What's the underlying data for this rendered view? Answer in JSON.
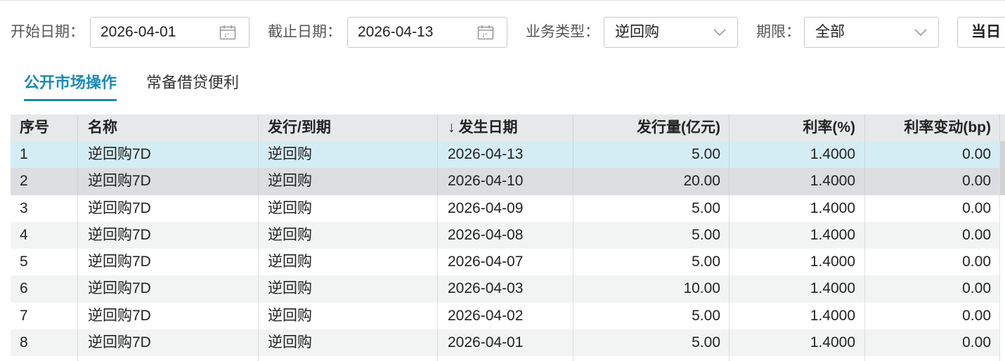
{
  "filters": {
    "start_date": {
      "label": "开始日期：",
      "value": "2026-04-01"
    },
    "end_date": {
      "label": "截止日期：",
      "value": "2026-04-13"
    },
    "business_type": {
      "label": "业务类型：",
      "value": "逆回购"
    },
    "term": {
      "label": "期限：",
      "value": "全部"
    },
    "today_button": {
      "label": "当日"
    }
  },
  "icons": {
    "date_picker": "calendar-icon",
    "select": "chevron-down-icon",
    "sort": "sort-desc-icon"
  },
  "tabs": [
    {
      "label": "公开市场操作",
      "active": true
    },
    {
      "label": "常备借贷便利",
      "active": false
    }
  ],
  "table": {
    "columns": [
      "序号",
      "名称",
      "发行/到期",
      "发生日期",
      "发行量(亿元)",
      "利率(%)",
      "利率变动(bp)"
    ],
    "sort_indicator": "↓",
    "rows": [
      {
        "cells": [
          "1",
          "逆回购7D",
          "逆回购",
          "2026-04-13",
          "5.00",
          "1.4000",
          "0.00"
        ],
        "selected": true,
        "hovered": false
      },
      {
        "cells": [
          "2",
          "逆回购7D",
          "逆回购",
          "2026-04-10",
          "20.00",
          "1.4000",
          "0.00"
        ],
        "selected": false,
        "hovered": true
      },
      {
        "cells": [
          "3",
          "逆回购7D",
          "逆回购",
          "2026-04-09",
          "5.00",
          "1.4000",
          "0.00"
        ],
        "selected": false,
        "hovered": false
      },
      {
        "cells": [
          "4",
          "逆回购7D",
          "逆回购",
          "2026-04-08",
          "5.00",
          "1.4000",
          "0.00"
        ],
        "selected": false,
        "hovered": false
      },
      {
        "cells": [
          "5",
          "逆回购7D",
          "逆回购",
          "2026-04-07",
          "5.00",
          "1.4000",
          "0.00"
        ],
        "selected": false,
        "hovered": false
      },
      {
        "cells": [
          "6",
          "逆回购7D",
          "逆回购",
          "2026-04-03",
          "10.00",
          "1.4000",
          "0.00"
        ],
        "selected": false,
        "hovered": false
      },
      {
        "cells": [
          "7",
          "逆回购7D",
          "逆回购",
          "2026-04-02",
          "5.00",
          "1.4000",
          "0.00"
        ],
        "selected": false,
        "hovered": false
      },
      {
        "cells": [
          "8",
          "逆回购7D",
          "逆回购",
          "2026-04-01",
          "5.00",
          "1.4000",
          "0.00"
        ],
        "selected": false,
        "hovered": false
      }
    ]
  },
  "colors": {
    "accent": "#1a8ab5",
    "text": "#222222",
    "label": "#555555",
    "tab_text": "#333333",
    "header_bg": "#e7e8e9",
    "selected_row": "#d4edf5",
    "hovered_row": "#dcdde0",
    "stripe_row": "#f2f4f4",
    "border": "#c9c9c9",
    "icon": "#8a8a8a",
    "divider": "#c2c2c2",
    "scroll_thumb": "#d2d2d2",
    "top_rule": "#e3e3e3"
  }
}
